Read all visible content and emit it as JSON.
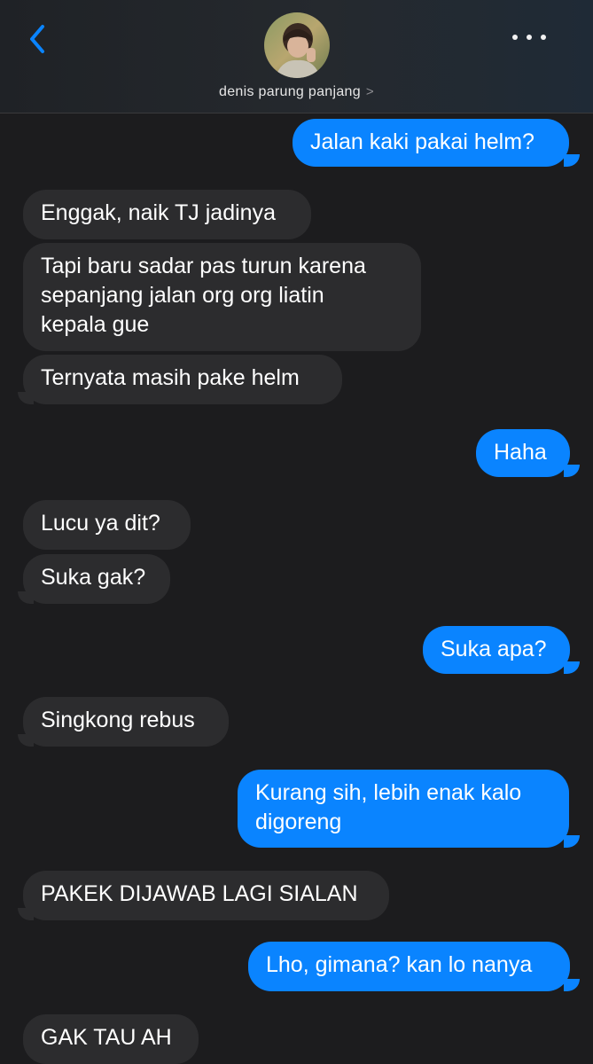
{
  "header": {
    "contact_name": "denis parung panjang",
    "chevron": ">",
    "back_icon": "chevron-left-icon",
    "more_icon": "ellipsis-icon",
    "accent": "#0a84ff"
  },
  "messages": [
    {
      "side": "out",
      "text": "Jalan kaki pakai helm?"
    },
    {
      "side": "in",
      "text": "Enggak, naik TJ jadinya"
    },
    {
      "side": "in",
      "lines": [
        "Tapi baru sadar pas turun karena",
        "sepanjang jalan org org liatin",
        "kepala gue"
      ]
    },
    {
      "side": "in",
      "text": "Ternyata masih pake helm"
    },
    {
      "side": "out",
      "text": "Haha"
    },
    {
      "side": "in",
      "text": "Lucu ya dit?"
    },
    {
      "side": "in",
      "text": "Suka gak?"
    },
    {
      "side": "out",
      "text": "Suka apa?"
    },
    {
      "side": "in",
      "text": "Singkong rebus"
    },
    {
      "side": "out",
      "lines": [
        "Kurang sih, lebih enak kalo",
        "digoreng"
      ]
    },
    {
      "side": "in",
      "text": "PAKEK DIJAWAB LAGI SIALAN"
    },
    {
      "side": "out",
      "text": "Lho, gimana? kan lo nanya"
    },
    {
      "side": "in",
      "text": "GAK TAU AH"
    }
  ],
  "colors": {
    "incoming_bubble": "#2c2c2e",
    "outgoing_bubble": "#0a84ff",
    "background": "#1c1c1e"
  }
}
